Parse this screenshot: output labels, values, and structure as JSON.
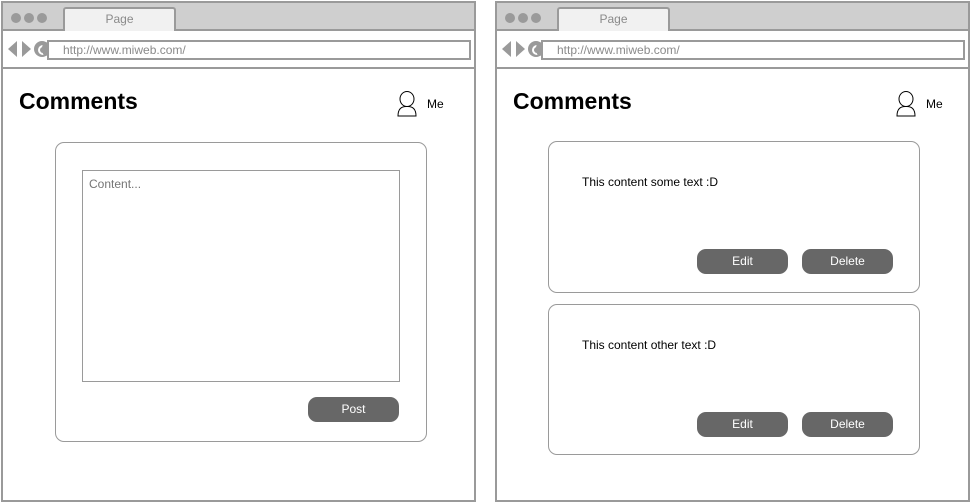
{
  "browser": {
    "tab_title": "Page",
    "url": "http://www.miweb.com/"
  },
  "colors": {
    "chrome": "#cfcfcf",
    "border": "#9a9a9a",
    "button": "#676767",
    "button_text": "#ffffff"
  },
  "compose_screen": {
    "title": "Comments",
    "user_label": "Me",
    "content_placeholder": "Content...",
    "post_label": "Post"
  },
  "list_screen": {
    "title": "Comments",
    "user_label": "Me",
    "comments": [
      {
        "text": "This content some text :D",
        "edit_label": "Edit",
        "delete_label": "Delete"
      },
      {
        "text": "This content other text :D",
        "edit_label": "Edit",
        "delete_label": "Delete"
      }
    ]
  }
}
